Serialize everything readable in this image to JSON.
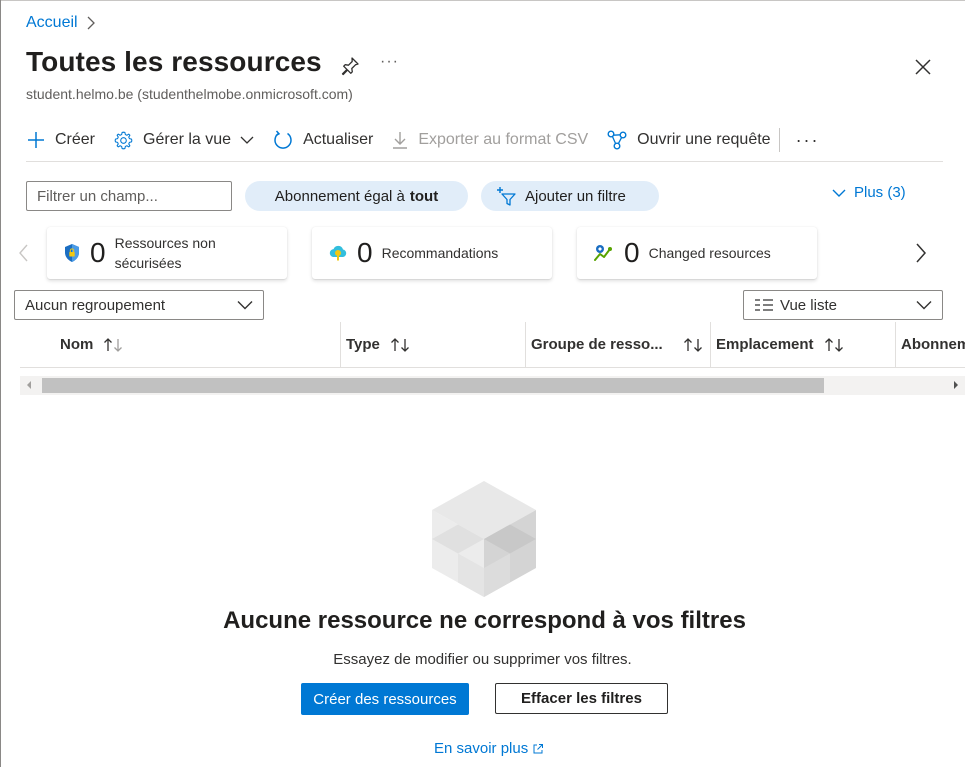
{
  "breadcrumb": {
    "home": "Accueil"
  },
  "header": {
    "title": "Toutes les ressources",
    "subtitle": "student.helmo.be (studenthelmobe.onmicrosoft.com)",
    "more": "···"
  },
  "toolbar": {
    "create": "Créer",
    "manage_view": "Gérer la vue",
    "refresh": "Actualiser",
    "export_csv": "Exporter au format CSV",
    "open_query": "Ouvrir une requête",
    "more": "···"
  },
  "filters": {
    "placeholder": "Filtrer un champ...",
    "subscription_prefix": "Abonnement égal à",
    "subscription_value": "tout",
    "add_filter": "Ajouter un filtre",
    "more": "Plus (3)"
  },
  "cards": [
    {
      "count": "0",
      "label_line1": "Ressources non",
      "label_line2": "sécurisées"
    },
    {
      "count": "0",
      "label": "Recommandations"
    },
    {
      "count": "0",
      "label": "Changed resources"
    }
  ],
  "grouping": {
    "selected": "Aucun regroupement"
  },
  "view": {
    "selected": "Vue liste"
  },
  "table": {
    "columns": [
      "Nom",
      "Type",
      "Groupe de resso...",
      "Emplacement",
      "Abonnem"
    ]
  },
  "empty_state": {
    "title": "Aucune ressource ne correspond à vos filtres",
    "subtitle": "Essayez de modifier ou supprimer vos filtres.",
    "create_button": "Créer des ressources",
    "clear_button": "Effacer les filtres",
    "learn_more": "En savoir plus"
  },
  "colors": {
    "accent": "#0078d4",
    "pill_bg": "#e1edf9",
    "text": "#323130"
  }
}
